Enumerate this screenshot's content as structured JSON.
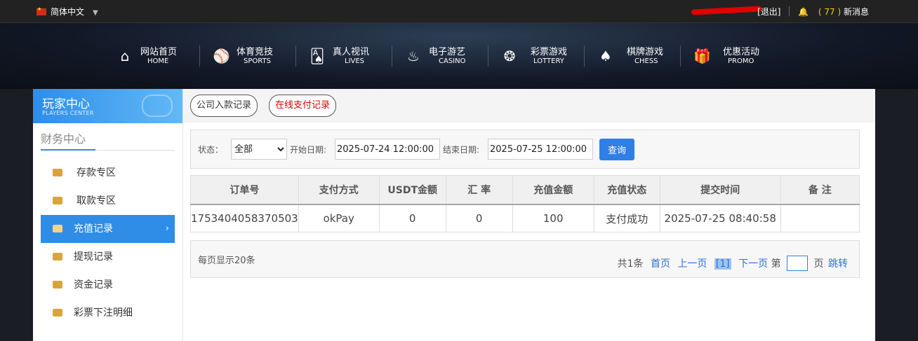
{
  "topbar": {
    "language": "简体中文",
    "logout": "[退出]",
    "msg_count": "( 77 )",
    "msg_label": "新消息"
  },
  "nav": [
    {
      "cn": "网站首页",
      "en": "HOME",
      "icon": "home-icon"
    },
    {
      "cn": "体育竞技",
      "en": "SPORTS",
      "icon": "ball-icon"
    },
    {
      "cn": "真人视讯",
      "en": "LIVES",
      "icon": "cards-icon"
    },
    {
      "cn": "电子游艺",
      "en": "CASINO",
      "icon": "slot-icon"
    },
    {
      "cn": "彩票游戏",
      "en": "LOTTERY",
      "icon": "lottery-balls-icon"
    },
    {
      "cn": "棋牌游戏",
      "en": "CHESS",
      "icon": "spade-icon"
    },
    {
      "cn": "优惠活动",
      "en": "PROMO",
      "icon": "gift-icon"
    }
  ],
  "sidebar": {
    "title_cn": "玩家中心",
    "title_en": "PLAYERS CENTER",
    "section": "财务中心",
    "items": [
      {
        "label": "存款专区",
        "active": false
      },
      {
        "label": "取款专区",
        "active": false
      },
      {
        "label": "充值记录",
        "active": true
      },
      {
        "label": "提现记录",
        "active": false
      },
      {
        "label": "资金记录",
        "active": false
      },
      {
        "label": "彩票下注明细",
        "active": false
      }
    ]
  },
  "tabs": {
    "company": "公司入款记录",
    "online": "在线支付记录"
  },
  "filter": {
    "status_label": "状态：",
    "status_value": "全部",
    "start_label": "开始日期:",
    "start_value": "2025-07-24 12:00:00",
    "end_label": "结束日期:",
    "end_value": "2025-07-25 12:00:00",
    "query_button": "查询"
  },
  "table": {
    "headers": [
      "订单号",
      "支付方式",
      "USDT金额",
      "汇 率",
      "充值金额",
      "充值状态",
      "提交时间",
      "备 注"
    ],
    "rows": [
      [
        "1753404058370503",
        "okPay",
        "0",
        "0",
        "100",
        "支付成功",
        "2025-07-25 08:40:58",
        ""
      ]
    ]
  },
  "pager": {
    "per_page": "每页显示20条",
    "total": "共1条",
    "first": "首页",
    "prev": "上一页",
    "current": "[1]",
    "next": "下一页",
    "page_prefix": "第",
    "page_suffix": "页",
    "goto": "跳转"
  },
  "colors": {
    "accent": "#2f8de8",
    "status_red": "#dd0000",
    "msg_yellow": "#f3d000"
  }
}
